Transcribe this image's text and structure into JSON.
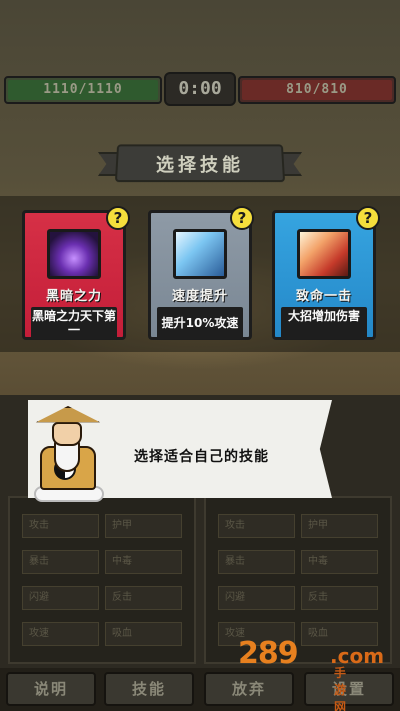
{
  "hud": {
    "player_hp": "1110/1110",
    "enemy_hp": "810/810",
    "timer": "0:00"
  },
  "banner": {
    "title": "选择技能"
  },
  "cards": [
    {
      "name": "黑暗之力",
      "desc": "黑暗之力天下第一",
      "color": "#c41e39",
      "icon": "dark-power-icon",
      "help": "?"
    },
    {
      "name": "速度提升",
      "desc": "提升10%攻速",
      "color": "#7a8794",
      "icon": "speed-up-icon",
      "help": "?"
    },
    {
      "name": "致命一击",
      "desc": "大招增加伤害",
      "color": "#2488c8",
      "icon": "critical-strike-icon",
      "help": "?"
    }
  ],
  "dialog": {
    "text": "选择适合自己的技能"
  },
  "stats_left": [
    [
      "攻击",
      "护甲"
    ],
    [
      "暴击",
      "中毒"
    ],
    [
      "闪避",
      "反击"
    ],
    [
      "攻速",
      "吸血"
    ]
  ],
  "stats_right": [
    [
      "攻击",
      "护甲"
    ],
    [
      "暴击",
      "中毒"
    ],
    [
      "闪避",
      "反击"
    ],
    [
      "攻速",
      "吸血"
    ]
  ],
  "buttons": {
    "info": "说明",
    "skills": "技能",
    "give_up": "放弃",
    "settings": "设置"
  },
  "watermark": {
    "number": "289",
    "com": ".com",
    "sub": "手游网"
  }
}
